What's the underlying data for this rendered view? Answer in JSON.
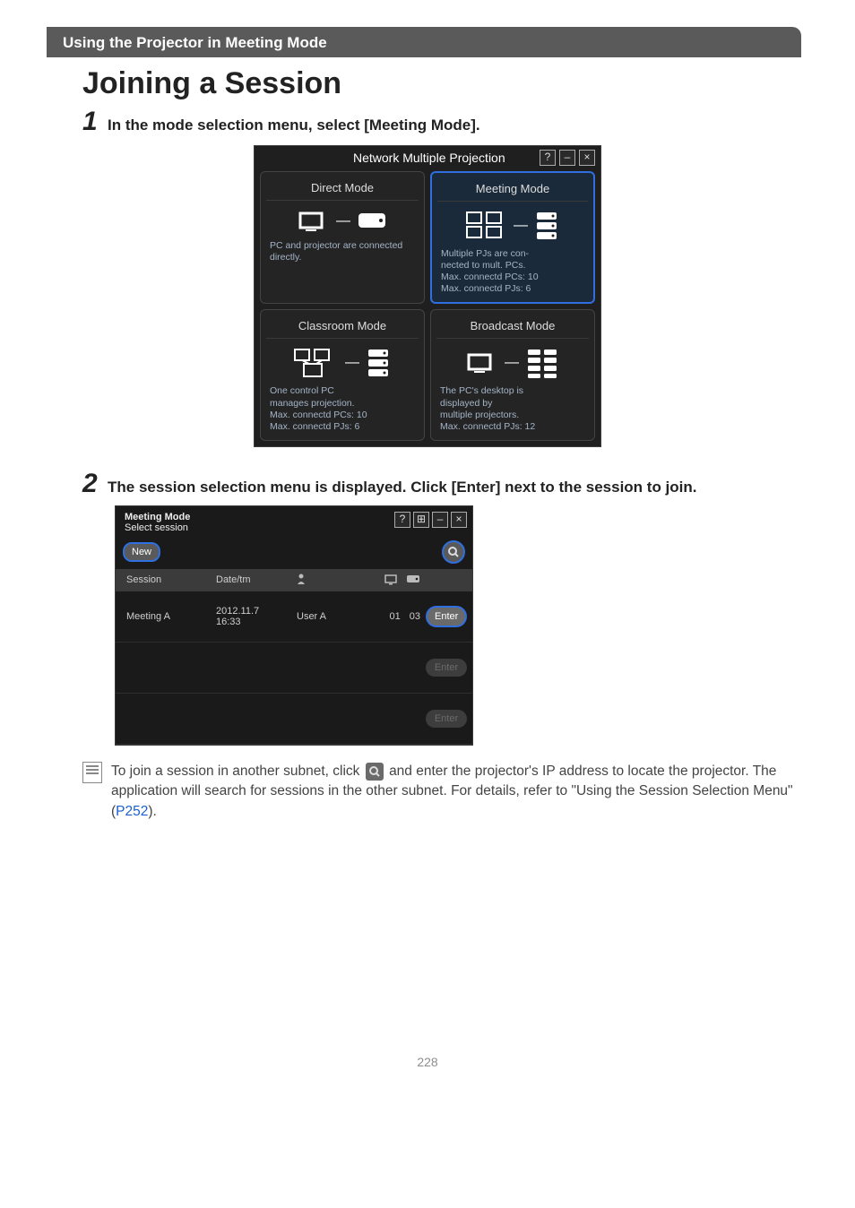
{
  "header": {
    "section_title": "Using the Projector in Meeting Mode"
  },
  "heading": "Joining a Session",
  "steps": {
    "s1": {
      "num": "1",
      "text": "In the mode selection menu, select [Meeting Mode]."
    },
    "s2": {
      "num": "2",
      "text": "The session selection menu is displayed. Click [Enter] next to the session to join."
    }
  },
  "nmp_window": {
    "title": "Network Multiple Projection",
    "help": "?",
    "min": "–",
    "close": "×",
    "modes": {
      "direct": {
        "title": "Direct Mode",
        "desc": "PC and projector are connected directly."
      },
      "meeting": {
        "title": "Meeting Mode",
        "desc": "Multiple PJs are con-\nnected to mult. PCs.\nMax. connectd PCs: 10\nMax. connectd PJs: 6"
      },
      "classroom": {
        "title": "Classroom Mode",
        "desc": "One control PC\nmanages projection.\nMax. connectd PCs: 10\nMax. connectd PJs: 6"
      },
      "broadcast": {
        "title": "Broadcast Mode",
        "desc": "The PC's desktop is\ndisplayed by\nmultiple projectors.\nMax. connectd PJs: 12"
      }
    }
  },
  "sess_window": {
    "title_line1": "Meeting Mode",
    "title_line2": "Select session",
    "help": "?",
    "grid": "⊞",
    "min": "–",
    "close": "×",
    "new_label": "New",
    "columns": {
      "session": "Session",
      "datetime": "Date/tm",
      "user": ""
    },
    "row": {
      "name": "Meeting A",
      "date": "2012.11.7",
      "time": "16:33",
      "user": "User A",
      "pc_count": "01",
      "pj_count": "03",
      "enter": "Enter"
    },
    "empty_enter": "Enter"
  },
  "note": {
    "text_before": "To join a session in another subnet, click ",
    "text_after": " and enter the projector's IP address to locate the projector. The application will search for sessions in the other subnet. For details, refer to \"Using the Session Selection Menu\" (",
    "link": "P252",
    "text_end": ")."
  },
  "page_number": "228"
}
